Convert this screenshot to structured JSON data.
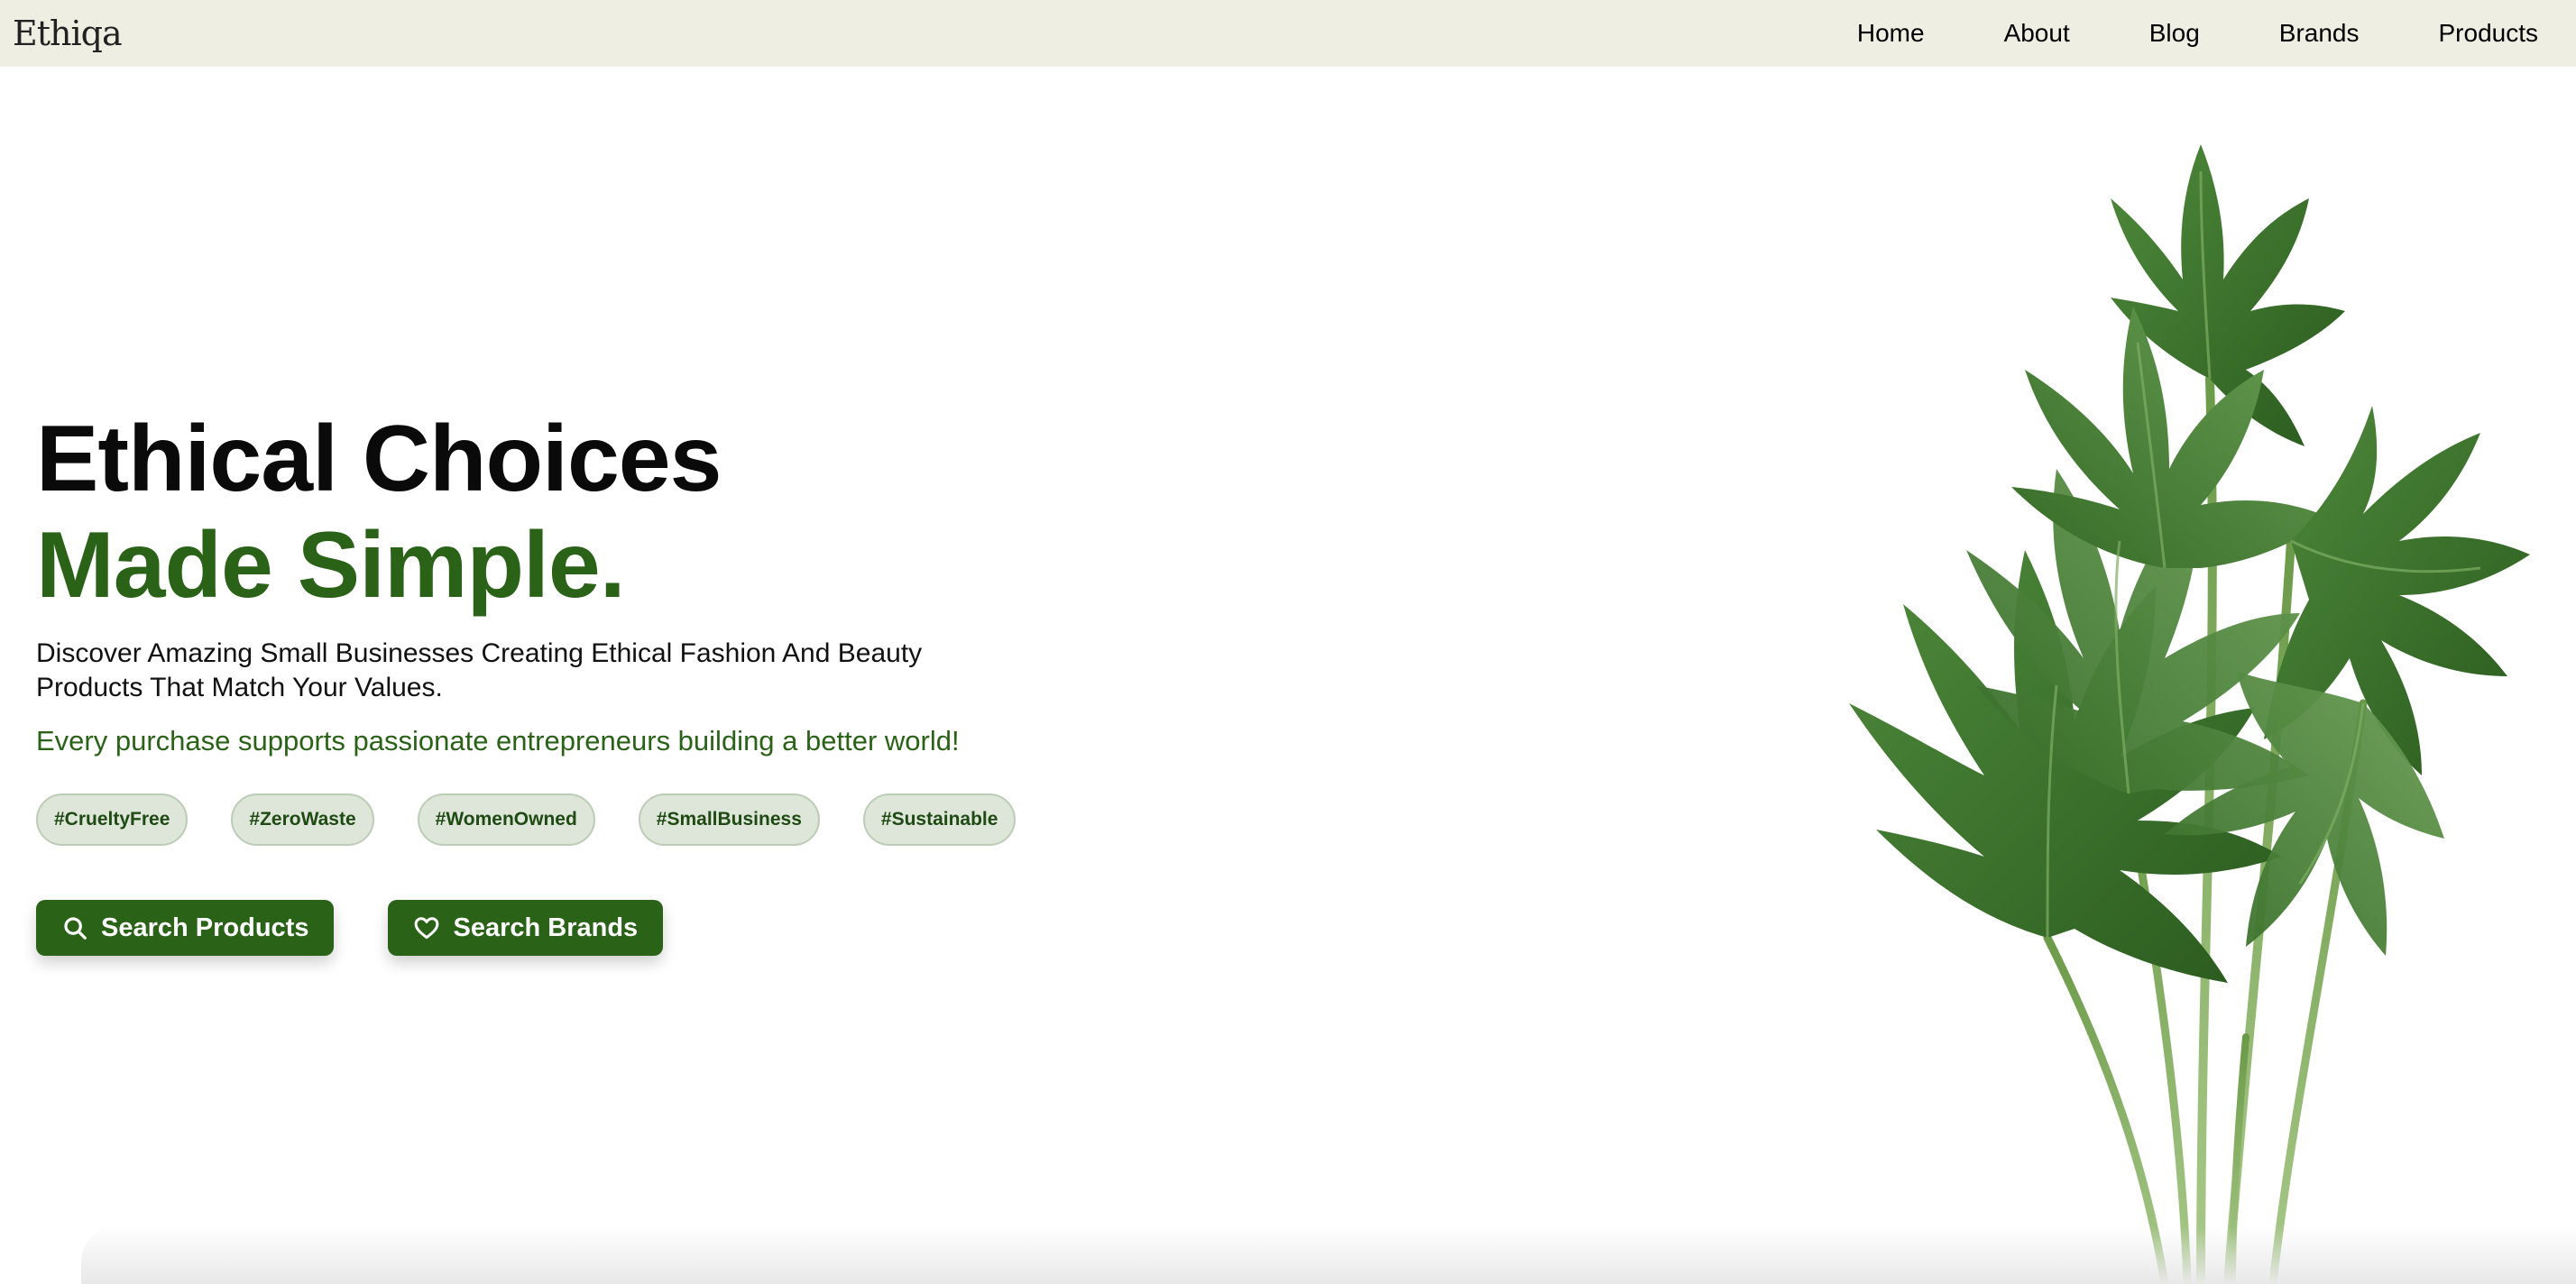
{
  "navbar": {
    "logo": "Ethiqa",
    "links": [
      "Home",
      "About",
      "Blog",
      "Brands",
      "Products"
    ]
  },
  "hero": {
    "headline_line1": "Ethical Choices",
    "headline_line2": "Made Simple.",
    "description": "Discover Amazing Small Businesses Creating Ethical Fashion And Beauty Products That Match Your Values.",
    "tagline": "Every purchase supports passionate entrepreneurs building a better world!",
    "tags": [
      "#CrueltyFree",
      "#ZeroWaste",
      "#WomenOwned",
      "#SmallBusiness",
      "#Sustainable"
    ],
    "buttons": {
      "search_products": "Search Products",
      "search_brands": "Search Brands"
    }
  },
  "colors": {
    "brand_green": "#2a6218",
    "navbar_bg": "#eeefe2",
    "tag_bg": "#dde6d8"
  },
  "icons": {
    "search": "search-icon",
    "heart": "heart-icon",
    "plant": "monstera-plant-image"
  }
}
